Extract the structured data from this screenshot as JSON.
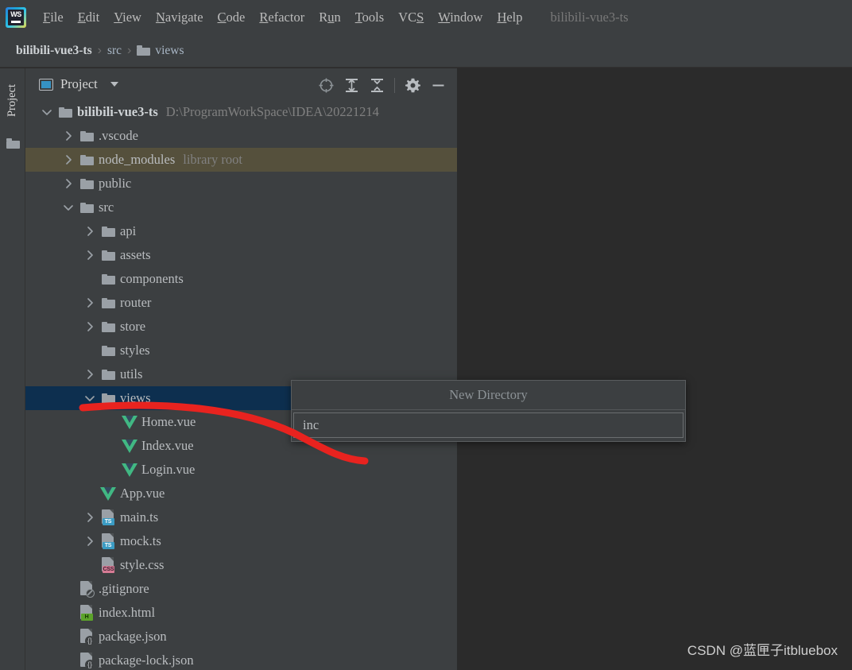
{
  "app": {
    "logo_icon": "webstorm-logo-icon",
    "logo_text": "WS",
    "window_title": "bilibili-vue3-ts"
  },
  "menubar": {
    "items": [
      {
        "label": "File",
        "mnemonic": "F"
      },
      {
        "label": "Edit",
        "mnemonic": "E"
      },
      {
        "label": "View",
        "mnemonic": "V"
      },
      {
        "label": "Navigate",
        "mnemonic": "N"
      },
      {
        "label": "Code",
        "mnemonic": "C"
      },
      {
        "label": "Refactor",
        "mnemonic": "R"
      },
      {
        "label": "Run",
        "mnemonic": "u"
      },
      {
        "label": "Tools",
        "mnemonic": "T"
      },
      {
        "label": "VCS",
        "mnemonic": "S"
      },
      {
        "label": "Window",
        "mnemonic": "W"
      },
      {
        "label": "Help",
        "mnemonic": "H"
      }
    ]
  },
  "breadcrumb": {
    "project": "bilibili-vue3-ts",
    "sep": "›",
    "src": "src",
    "folder_icon": "folder-icon",
    "views": "views"
  },
  "toolstrip": {
    "project_tab_label": "Project",
    "folder_icon": "folder-icon"
  },
  "panel": {
    "icon": "project-view-icon",
    "title": "Project",
    "dropdown_icon": "chevron-down-icon",
    "tools": [
      {
        "name": "select-opened-file-icon",
        "label": ""
      },
      {
        "name": "expand-all-icon",
        "label": ""
      },
      {
        "name": "collapse-all-icon",
        "label": ""
      },
      {
        "name": "settings-gear-icon",
        "label": ""
      },
      {
        "name": "hide-panel-icon",
        "label": ""
      }
    ]
  },
  "tree": {
    "rows": [
      {
        "indent": 0,
        "chevron": "down",
        "icon": "folder",
        "label": "bilibili-vue3-ts",
        "bold": true,
        "sublabel": "D:\\ProgramWorkSpace\\IDEA\\20221214",
        "state": "normal"
      },
      {
        "indent": 1,
        "chevron": "right",
        "icon": "folder",
        "label": ".vscode",
        "bold": false,
        "sublabel": "",
        "state": "normal"
      },
      {
        "indent": 1,
        "chevron": "right",
        "icon": "folder",
        "label": "node_modules",
        "bold": false,
        "sublabel": "library root",
        "state": "library"
      },
      {
        "indent": 1,
        "chevron": "right",
        "icon": "folder",
        "label": "public",
        "bold": false,
        "sublabel": "",
        "state": "normal"
      },
      {
        "indent": 1,
        "chevron": "down",
        "icon": "folder",
        "label": "src",
        "bold": false,
        "sublabel": "",
        "state": "normal"
      },
      {
        "indent": 2,
        "chevron": "right",
        "icon": "folder",
        "label": "api",
        "bold": false,
        "sublabel": "",
        "state": "normal"
      },
      {
        "indent": 2,
        "chevron": "right",
        "icon": "folder",
        "label": "assets",
        "bold": false,
        "sublabel": "",
        "state": "normal"
      },
      {
        "indent": 2,
        "chevron": "none",
        "icon": "folder",
        "label": "components",
        "bold": false,
        "sublabel": "",
        "state": "normal"
      },
      {
        "indent": 2,
        "chevron": "right",
        "icon": "folder",
        "label": "router",
        "bold": false,
        "sublabel": "",
        "state": "normal"
      },
      {
        "indent": 2,
        "chevron": "right",
        "icon": "folder",
        "label": "store",
        "bold": false,
        "sublabel": "",
        "state": "normal"
      },
      {
        "indent": 2,
        "chevron": "none",
        "icon": "folder",
        "label": "styles",
        "bold": false,
        "sublabel": "",
        "state": "normal"
      },
      {
        "indent": 2,
        "chevron": "right",
        "icon": "folder",
        "label": "utils",
        "bold": false,
        "sublabel": "",
        "state": "normal"
      },
      {
        "indent": 2,
        "chevron": "down",
        "icon": "folder",
        "label": "views",
        "bold": false,
        "sublabel": "",
        "state": "selected"
      },
      {
        "indent": 3,
        "chevron": "none",
        "icon": "vue",
        "label": "Home.vue",
        "bold": false,
        "sublabel": "",
        "state": "normal"
      },
      {
        "indent": 3,
        "chevron": "none",
        "icon": "vue",
        "label": "Index.vue",
        "bold": false,
        "sublabel": "",
        "state": "normal"
      },
      {
        "indent": 3,
        "chevron": "none",
        "icon": "vue",
        "label": "Login.vue",
        "bold": false,
        "sublabel": "",
        "state": "normal"
      },
      {
        "indent": 2,
        "chevron": "none",
        "icon": "vue",
        "label": "App.vue",
        "bold": false,
        "sublabel": "",
        "state": "normal"
      },
      {
        "indent": 2,
        "chevron": "right",
        "icon": "ts",
        "label": "main.ts",
        "bold": false,
        "sublabel": "",
        "state": "normal"
      },
      {
        "indent": 2,
        "chevron": "right",
        "icon": "ts",
        "label": "mock.ts",
        "bold": false,
        "sublabel": "",
        "state": "normal"
      },
      {
        "indent": 2,
        "chevron": "none",
        "icon": "css",
        "label": "style.css",
        "bold": false,
        "sublabel": "",
        "state": "normal"
      },
      {
        "indent": 1,
        "chevron": "none",
        "icon": "ignore",
        "label": ".gitignore",
        "bold": false,
        "sublabel": "",
        "state": "normal"
      },
      {
        "indent": 1,
        "chevron": "none",
        "icon": "html",
        "label": "index.html",
        "bold": false,
        "sublabel": "",
        "state": "normal"
      },
      {
        "indent": 1,
        "chevron": "none",
        "icon": "json",
        "label": "package.json",
        "bold": false,
        "sublabel": "",
        "state": "normal"
      },
      {
        "indent": 1,
        "chevron": "none",
        "icon": "json",
        "label": "package-lock.json",
        "bold": false,
        "sublabel": "",
        "state": "normal"
      }
    ]
  },
  "new_directory_dialog": {
    "title": "New Directory",
    "input_value": "inc",
    "input_placeholder": ""
  },
  "watermark": {
    "text": "CSDN @蓝匣子itbluebox"
  },
  "colors": {
    "panel_bg": "#3c3f41",
    "editor_bg": "#2b2b2b",
    "selection": "#0d2f4f",
    "library_root": "#55503c",
    "text": "#b9bcbf",
    "muted_text": "#808080",
    "vue_green": "#41b883",
    "ts_blue": "#3b9cc4",
    "css_pink": "#d67b94",
    "html_green": "#5ca32a",
    "annotation_red": "#e8231f"
  }
}
